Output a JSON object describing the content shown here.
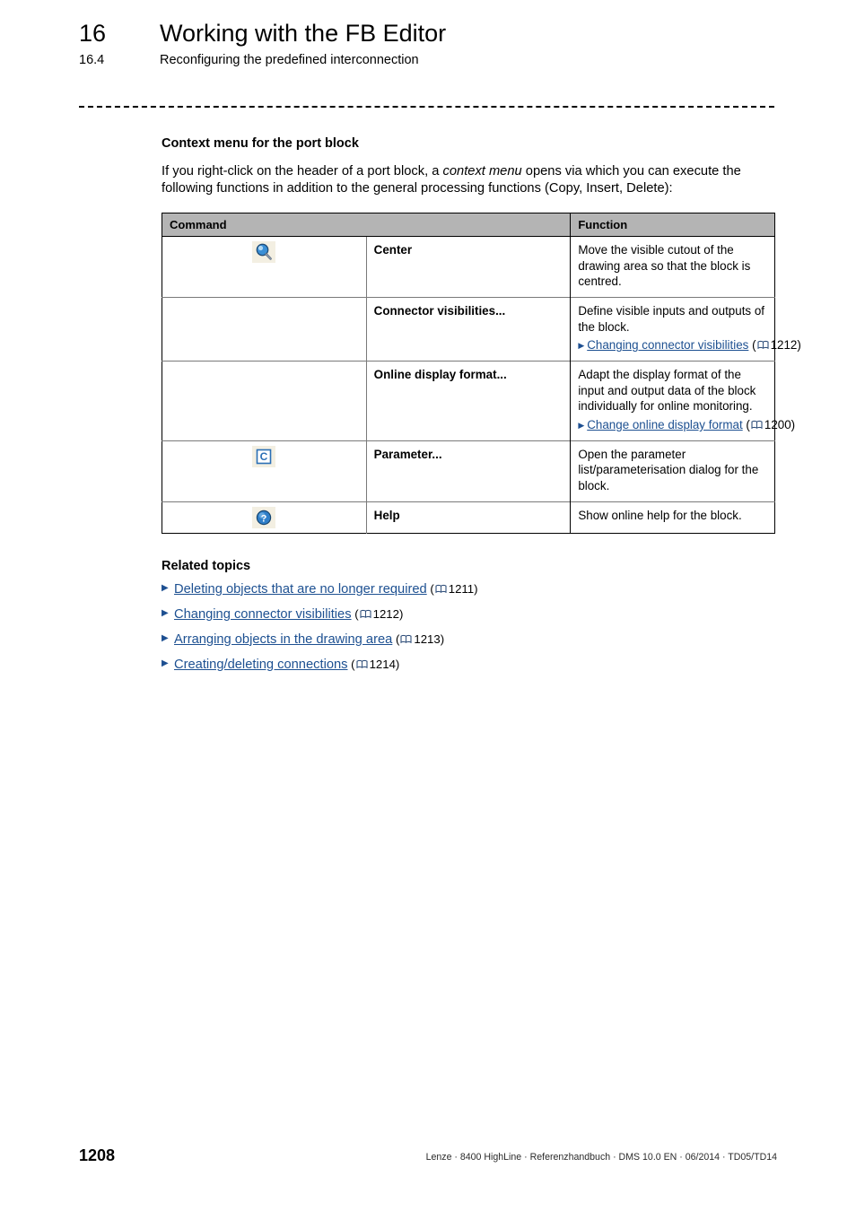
{
  "header": {
    "chapter_number": "16",
    "chapter_title": "Working with the FB Editor",
    "section_number": "16.4",
    "section_title": "Reconfiguring the predefined interconnection"
  },
  "body": {
    "subheading": "Context menu for the port block",
    "intro_part1": "If you right-click on the header of a port block, a ",
    "intro_italic": "context menu",
    "intro_part2": " opens via which you can execute the following functions in addition to the general processing functions (Copy, Insert, Delete):"
  },
  "table": {
    "columns": [
      "Command",
      "Function"
    ],
    "rows": [
      {
        "icon": "magnifier-icon",
        "command": "Center",
        "function": "Move the visible cutout of the drawing area so that the block is centred.",
        "link": null,
        "link_page": null
      },
      {
        "icon": null,
        "command": "Connector visibilities...",
        "function": "Define visible inputs and outputs of the block.",
        "link": "Changing connector visibilities",
        "link_page": "1212"
      },
      {
        "icon": null,
        "command": "Online display format...",
        "function": "Adapt the display format of the input and output data of the block individually for online monitoring.",
        "link": "Change online display format",
        "link_page": "1200"
      },
      {
        "icon": "parameter-c-icon",
        "command": "Parameter...",
        "function": "Open the parameter list/parameterisation dialog for the block.",
        "link": null,
        "link_page": null
      },
      {
        "icon": "help-question-icon",
        "command": "Help",
        "function": "Show online help for the block.",
        "link": null,
        "link_page": null
      }
    ]
  },
  "related": {
    "heading": "Related topics",
    "items": [
      {
        "label": "Deleting objects that are no longer required",
        "page": "1211"
      },
      {
        "label": "Changing connector visibilities",
        "page": "1212"
      },
      {
        "label": "Arranging objects in the drawing area",
        "page": "1213"
      },
      {
        "label": "Creating/deleting connections",
        "page": "1214"
      }
    ]
  },
  "footer": {
    "page_number": "1208",
    "imprint": "Lenze · 8400 HighLine · Referenzhandbuch · DMS 10.0 EN · 06/2014 · TD05/TD14"
  },
  "colors": {
    "link": "#1d5091",
    "table_header_bg": "#b4b4b4",
    "icon_bg": "#f3efe2"
  }
}
